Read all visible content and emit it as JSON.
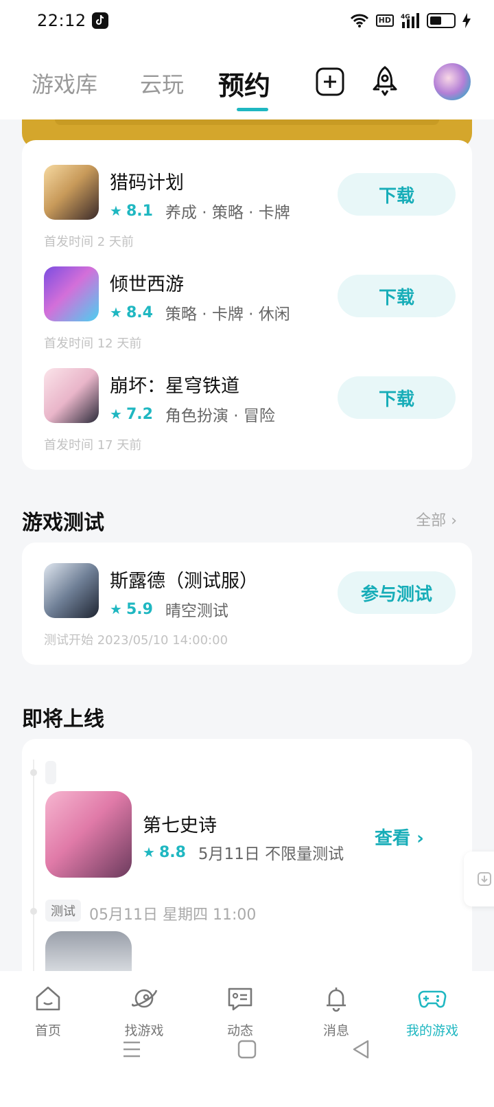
{
  "status_bar": {
    "time": "22:12",
    "hd": "HD",
    "network": "4G"
  },
  "header": {
    "tabs": [
      "游戏库",
      "云玩",
      "预约"
    ],
    "active_tab": "预约",
    "icons": [
      "add-square-icon",
      "rocket-icon",
      "avatar"
    ]
  },
  "released_games": [
    {
      "name": "猎码计划",
      "score": "8.1",
      "tags": "养成 · 策略 · 卡牌",
      "release": "首发时间 2 天前",
      "button": "下载"
    },
    {
      "name": "倾世西游",
      "score": "8.4",
      "tags": "策略 · 卡牌 · 休闲",
      "release": "首发时间 12 天前",
      "button": "下载"
    },
    {
      "name": "崩坏：星穹铁道",
      "score": "7.2",
      "tags": "角色扮演 · 冒险",
      "release": "首发时间 17 天前",
      "button": "下载"
    }
  ],
  "test_section": {
    "title": "游戏测试",
    "more": "全部",
    "game": {
      "name": "斯露德（测试服）",
      "score": "5.9",
      "tags": "晴空测试",
      "start": "测试开始 2023/05/10 14:00:00",
      "button": "参与测试"
    }
  },
  "upcoming_section": {
    "title": "即将上线",
    "game": {
      "name": "第七史诗",
      "score": "8.8",
      "desc": "5月11日 不限量测试",
      "button": "查看"
    },
    "next_tag": "测试",
    "next_date": "05月11日 星期四 11:00"
  },
  "bottom_nav": [
    {
      "label": "首页",
      "icon": "home-icon"
    },
    {
      "label": "找游戏",
      "icon": "planet-icon"
    },
    {
      "label": "动态",
      "icon": "chat-icon"
    },
    {
      "label": "消息",
      "icon": "bell-icon"
    },
    {
      "label": "我的游戏",
      "icon": "gamepad-icon"
    }
  ],
  "colors": {
    "accent": "#1fb7c1",
    "banner": "#d4a62c"
  }
}
